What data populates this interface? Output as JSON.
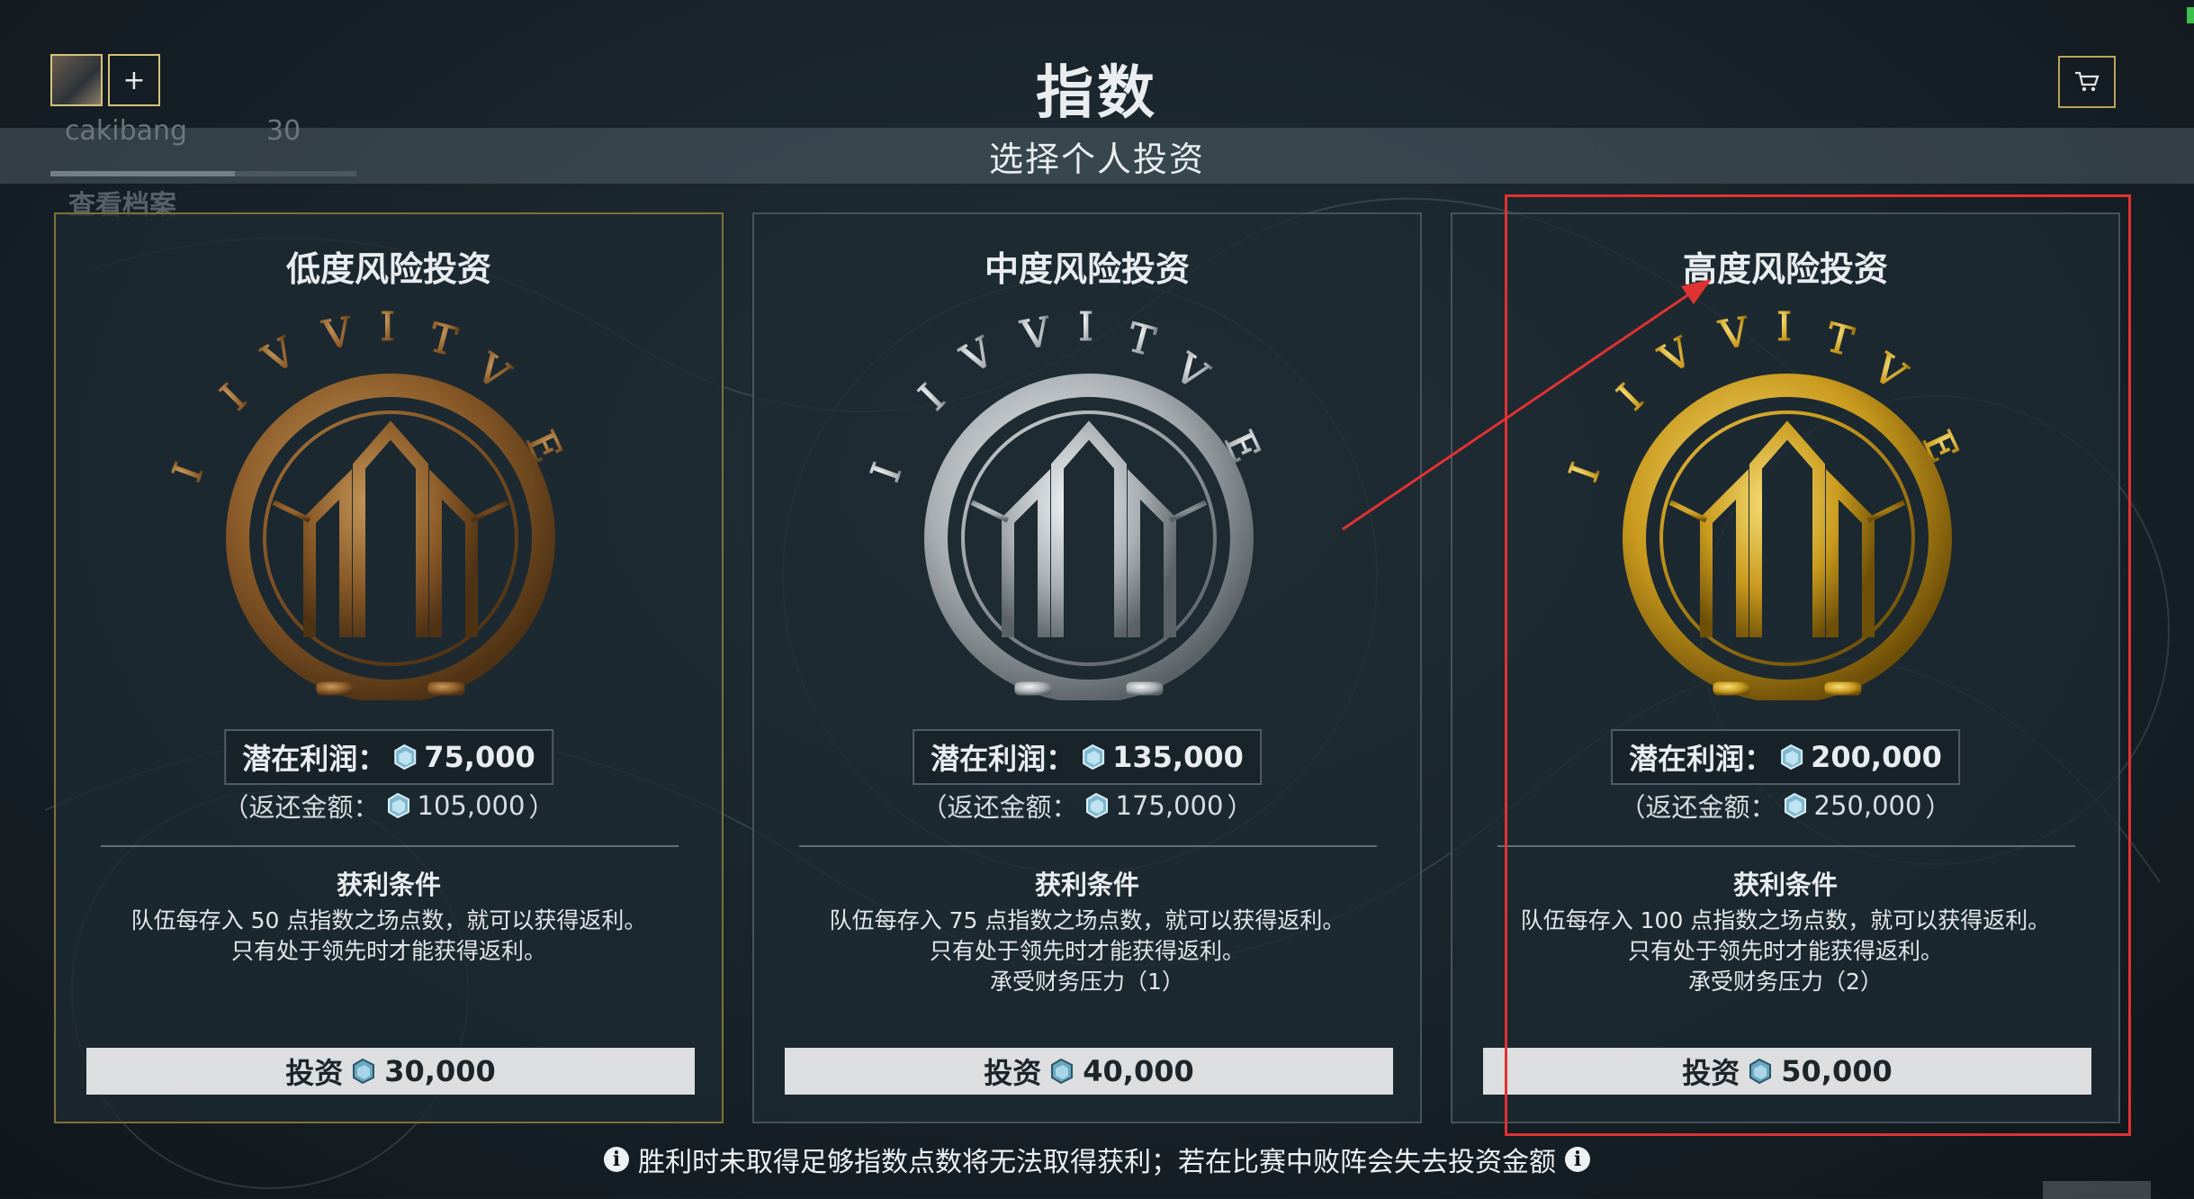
{
  "header": {
    "title": "指数",
    "subtitle": "选择个人投资",
    "add_label": "+"
  },
  "background_overlay": {
    "player_name": "cakibang",
    "player_level": "30",
    "view_profile": "查看档案"
  },
  "currency_icon": "platinum-icon",
  "cards": [
    {
      "title": "低度风险投资",
      "tier_color": "#9a6a34",
      "profit_label": "潜在利润：",
      "profit_value": "75,000",
      "refund_prefix": "（返还金额：",
      "refund_value": "105,000",
      "refund_suffix": "）",
      "condition_title": "获利条件",
      "condition_line1": "队伍每存入 50 点指数之场点数，就可以获得返利。",
      "condition_line2": "只有处于领先时才能获得返利。",
      "condition_line3": "",
      "invest_label": "投资",
      "invest_value": "30,000"
    },
    {
      "title": "中度风险投资",
      "tier_color": "#b8bcbf",
      "profit_label": "潜在利润：",
      "profit_value": "135,000",
      "refund_prefix": "（返还金额：",
      "refund_value": "175,000",
      "refund_suffix": "）",
      "condition_title": "获利条件",
      "condition_line1": "队伍每存入 75 点指数之场点数，就可以获得返利。",
      "condition_line2": "只有处于领先时才能获得返利。",
      "condition_line3": "承受财务压力（1）",
      "invest_label": "投资",
      "invest_value": "40,000"
    },
    {
      "title": "高度风险投资",
      "tier_color": "#d4a92a",
      "profit_label": "潜在利润：",
      "profit_value": "200,000",
      "refund_prefix": "（返还金额：",
      "refund_value": "250,000",
      "refund_suffix": "）",
      "condition_title": "获利条件",
      "condition_line1": "队伍每存入 100 点指数之场点数，就可以获得返利。",
      "condition_line2": "只有处于领先时才能获得返利。",
      "condition_line3": "承受财务压力（2）",
      "invest_label": "投资",
      "invest_value": "50,000"
    }
  ],
  "footer": {
    "warning": "胜利时未取得足够指数点数将无法取得获利；若在比赛中败阵会失去投资金额"
  },
  "annotation": {
    "highlight_color": "#e03232"
  }
}
